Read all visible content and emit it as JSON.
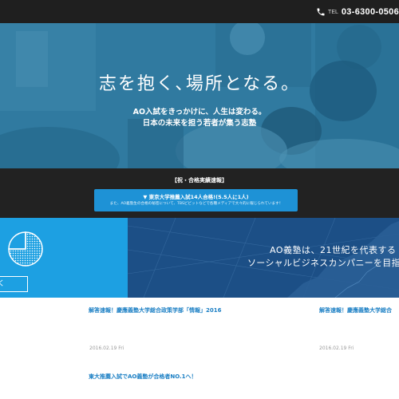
{
  "header": {
    "phone_label": "TEL",
    "phone_number": "03-6300-0506",
    "icon": "phone-icon",
    "background": "#1f1f1f"
  },
  "hero": {
    "tagline": "志を抱く､場所となる。",
    "sub1": "AO入試をきっかけに、人生は変わる。",
    "sub2": "日本の未来を担う若者が集う志塾"
  },
  "news": {
    "heading": "【祝・合格実績速報】",
    "main": "▼ 東京大学推薦入試14人合格!(5.5人に1人)",
    "detail": "また、AO義塾生の合格の秘密について、TBSビビットなどで各種メディアで大々的に報じられています！",
    "accent": "#1e92d6"
  },
  "banners": {
    "left": {
      "button_label": "く",
      "icon": "pie-chart-icon",
      "color": "#1da0e2"
    },
    "right": {
      "line1": "AO義塾は、21世紀を代表する",
      "line2": "ソーシャルビジネスカンパニーを目指し",
      "color": "#1c4f86"
    }
  },
  "articles": [
    {
      "title": "解答速報！慶應義塾大学総合政策学部「情報」2016",
      "date": "2016.02.19 Fri"
    },
    {
      "title": "解答速報！慶應義塾大学総合",
      "date": "2016.02.19 Fri"
    },
    {
      "title": "東大推薦入試でAO義塾が合格者NO.1へ！",
      "date": ""
    }
  ]
}
